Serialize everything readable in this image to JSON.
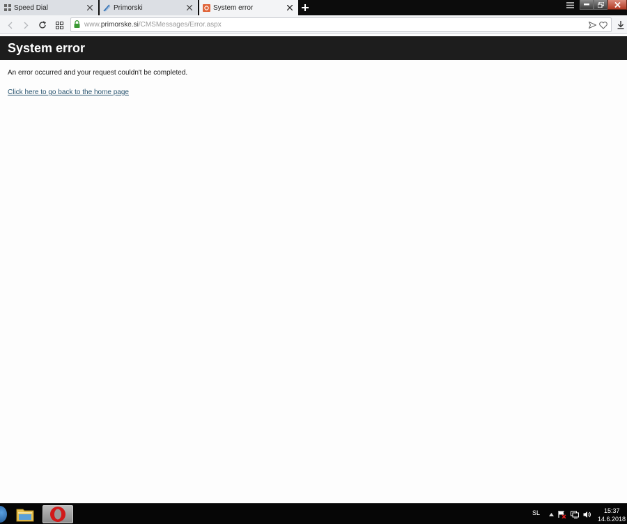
{
  "tabs": [
    {
      "title": "Speed Dial",
      "icon": "speed-dial-icon",
      "active": false
    },
    {
      "title": "Primorski",
      "icon": "primorski-favicon",
      "active": false
    },
    {
      "title": "System error",
      "icon": "error-favicon",
      "active": true
    }
  ],
  "address_bar": {
    "url_prefix": "www.",
    "url_host": "primorske.si",
    "url_path": "/CMSMessages/Error.aspx",
    "secure": true
  },
  "page": {
    "title": "System error",
    "message": "An error occurred and your request couldn't be completed.",
    "home_link": "Click here to go back to the home page"
  },
  "taskbar": {
    "language": "SL",
    "time": "15:37",
    "date": "14.6.2018"
  },
  "colors": {
    "header_bg": "#1d1d1d",
    "link": "#2a5570",
    "error_favicon": "#e0653a",
    "secure_lock": "#3a9a35"
  }
}
